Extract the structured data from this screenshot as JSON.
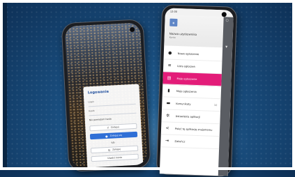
{
  "left_phone": {
    "login": {
      "title": "Logowanie",
      "field_label": "Login",
      "password_label": "Hasło",
      "forgot": "Nie pamiętam hasła",
      "other_text": "lub",
      "btn_facebook": "Zaloguj",
      "btn_primary": "Zaloguj się",
      "btn_google": "Zaloguj",
      "btn_register": "Utwórz konto"
    }
  },
  "right_phone": {
    "status_time": "12:00",
    "user_name": "Nazwa użytkownika",
    "user_sub": "Konto",
    "menu": [
      {
        "icon": "info-icon",
        "glyph": "●",
        "label": "Nowe ogłoszenie",
        "badge": "",
        "active": false
      },
      {
        "icon": "list-icon",
        "glyph": "≡",
        "label": "Lista ogłoszeń",
        "badge": "",
        "active": false
      },
      {
        "icon": "document-icon",
        "glyph": "▤",
        "label": "Moje ogłoszenie",
        "badge": "",
        "active": true
      },
      {
        "icon": "bookmark-icon",
        "glyph": "▮",
        "label": "Moje ogłoszenia",
        "badge": "",
        "active": false
      },
      {
        "icon": "chat-icon",
        "glyph": "▬",
        "label": "Komunikaty",
        "badge": "10",
        "active": false
      },
      {
        "icon": "gear-icon",
        "glyph": "✲",
        "label": "Ustawienia aplikacji",
        "badge": "",
        "active": false
      },
      {
        "icon": "share-icon",
        "glyph": "<",
        "label": "Poleć tę aplikację znajomemu",
        "badge": "",
        "active": false
      },
      {
        "icon": "exit-icon",
        "glyph": "⇥",
        "label": "Zakończ",
        "badge": "",
        "active": false
      }
    ]
  },
  "colors": {
    "accent": "#e31c79",
    "primary_button": "#2f6fd6",
    "background": "#1a4f80"
  }
}
